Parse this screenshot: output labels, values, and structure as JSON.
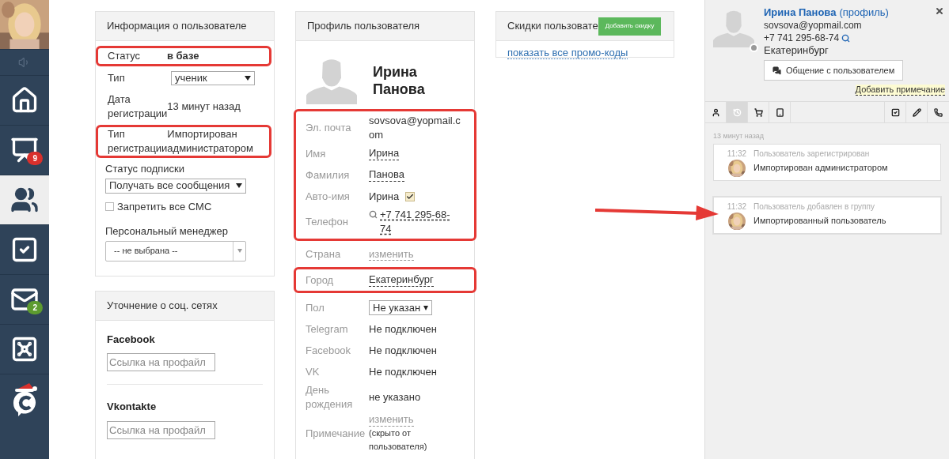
{
  "sidebar": {
    "items": [
      {
        "kind": "sound",
        "selected": false
      },
      {
        "kind": "home",
        "selected": false
      },
      {
        "kind": "chart",
        "selected": false,
        "badge": "9",
        "color": "#d9302c"
      },
      {
        "kind": "people",
        "selected": true
      },
      {
        "kind": "tasks",
        "selected": false
      },
      {
        "kind": "mail",
        "selected": false,
        "badge": "2",
        "color": "#5d9b2f"
      },
      {
        "kind": "safe",
        "selected": false
      },
      {
        "kind": "logo",
        "selected": false
      }
    ]
  },
  "user_info": {
    "title": "Информация о пользователе",
    "rows": [
      {
        "label": "Статус",
        "value": "в базе",
        "kind": "bold",
        "highlighted": true
      },
      {
        "label": "Тип",
        "value": "ученик",
        "kind": "select",
        "highlighted": false
      },
      {
        "label": "Дата регистрации",
        "value": "13 минут назад",
        "kind": "text",
        "highlighted": false
      },
      {
        "label": "Тип регистрации",
        "value": "Импортирован администратором",
        "kind": "text",
        "highlighted": true
      }
    ],
    "subscription": {
      "label": "Статус подписки",
      "value": "Получать все сообщения"
    },
    "sms_block": {
      "label": "Запретить все СМС",
      "checked": false
    },
    "manager": {
      "label": "Персональный менеджер",
      "value": "-- не выбрана --"
    }
  },
  "social": {
    "title": "Уточнение о соц. сетях",
    "sections": [
      {
        "label": "Facebook",
        "placeholder": "Ссылка на профайл"
      },
      {
        "label": "Vkontakte",
        "placeholder": "Ссылка на профайл"
      }
    ]
  },
  "profile": {
    "title": "Профиль пользователя",
    "name": "Ирина Панова",
    "groups": [
      {
        "highlighted": true,
        "rows": [
          {
            "label": "Эл. почта",
            "value": "sovsova@yopmail.com",
            "kind": "email"
          },
          {
            "label": "Имя",
            "value": "Ирина",
            "kind": "editable"
          },
          {
            "label": "Фамилия",
            "value": "Панова",
            "kind": "editable"
          },
          {
            "label": "Авто-имя",
            "value": "Ирина",
            "kind": "check",
            "checked": true
          },
          {
            "label": "Телефон",
            "value": "+7 741 295-68-74",
            "kind": "phone"
          }
        ]
      },
      {
        "highlighted": false,
        "rows": [
          {
            "label": "Страна",
            "value": "изменить",
            "kind": "link"
          }
        ]
      },
      {
        "highlighted": true,
        "rows": [
          {
            "label": "Город",
            "value": "Екатеринбург",
            "kind": "editable"
          }
        ]
      },
      {
        "highlighted": false,
        "rows": [
          {
            "label": "Пол",
            "value": "Не указан",
            "kind": "select"
          },
          {
            "label": "Telegram",
            "value": "Не подключен",
            "kind": "text"
          },
          {
            "label": "Facebook",
            "value": "Не подключен",
            "kind": "text"
          },
          {
            "label": "VK",
            "value": "Не подключен",
            "kind": "text"
          },
          {
            "label": "День рождения",
            "value": "не указано",
            "kind": "text"
          },
          {
            "label": "Примечание",
            "value": "изменить",
            "kind": "note",
            "note": "(скрыто от пользователя)"
          }
        ]
      }
    ]
  },
  "discounts": {
    "title": "Скидки пользовате",
    "button": "Добавить скидку",
    "link": "показать все промо-коды"
  },
  "panel": {
    "name": "Ирина Панова",
    "profile_link": "(профиль)",
    "email": "sovsova@yopmail.com",
    "phone": "+7 741 295-68-74",
    "city": "Екатеринбург",
    "chat_button": "Общение с пользователем",
    "note_link": "Добавить примечание",
    "tabs": [
      {
        "kind": "user",
        "selected": false
      },
      {
        "kind": "history",
        "selected": true
      },
      {
        "kind": "cart",
        "selected": false
      },
      {
        "kind": "tablet",
        "selected": false
      },
      {
        "kind": "spacer"
      },
      {
        "kind": "task",
        "selected": false
      },
      {
        "kind": "pencil",
        "selected": false
      },
      {
        "kind": "phone",
        "selected": false
      }
    ],
    "feed_date": "13 минут назад",
    "events": [
      {
        "time": "11:32",
        "title": "Пользователь зарегистрирован",
        "text": "Импортирован администратором",
        "pointed": false
      },
      {
        "time": "11:32",
        "title": "Пользователь добавлен в группу",
        "text": "Импортированный пользователь",
        "pointed": true
      }
    ]
  }
}
